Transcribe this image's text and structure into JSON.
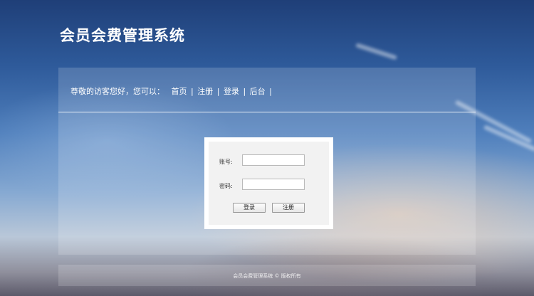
{
  "header": {
    "title": "会员会费管理系统"
  },
  "nav": {
    "greeting": "尊敬的访客您好，您可以：",
    "links": [
      "首页",
      "注册",
      "登录",
      "后台"
    ],
    "separator": "|"
  },
  "login": {
    "account_label": "账号:",
    "password_label": "密码:",
    "account_value": "",
    "password_value": "",
    "login_button": "登录",
    "register_button": "注册"
  },
  "footer": {
    "text": "会员会费管理系统 © 版权所有"
  }
}
